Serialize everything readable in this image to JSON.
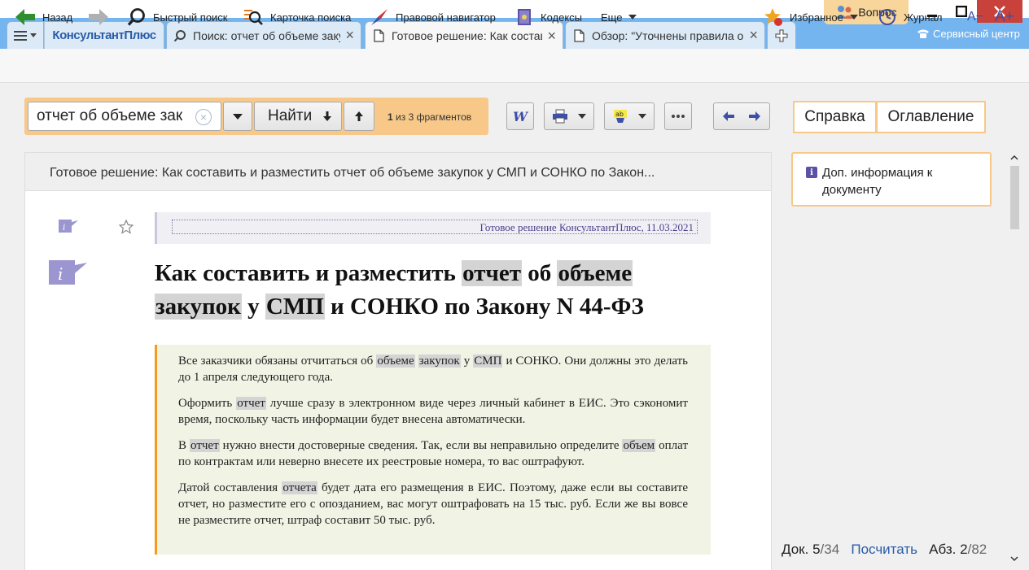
{
  "tabs": {
    "logo": "КонсультантПлюс",
    "items": [
      {
        "label": "Поиск: отчет об объеме закупок",
        "icon": "search-icon"
      },
      {
        "label": "Готовое решение: Как составить",
        "icon": "document-icon"
      },
      {
        "label": "Обзор: \"Уточнены правила оп",
        "icon": "document-icon"
      }
    ]
  },
  "window": {
    "question": "Вопрос",
    "service_center": "Сервисный центр"
  },
  "toolbar": {
    "back": "Назад",
    "quick_search": "Быстрый поиск",
    "search_card": "Карточка поиска",
    "legal_navigator": "Правовой навигатор",
    "codes": "Кодексы",
    "more": "Еще",
    "favorites": "Избранное",
    "journal": "Журнал",
    "font_smaller": "A−",
    "font_bigger": "A+"
  },
  "search": {
    "value": "отчет об объеме зак",
    "find_label": "Найти",
    "fragment_count": "1",
    "fragment_text": "из 3 фрагментов"
  },
  "side": {
    "help_tab": "Справка",
    "contents_tab": "Оглавление",
    "info_label": "Доп. информация к документу"
  },
  "document": {
    "title_bar": "Готовое решение: Как составить и разместить отчет об объеме закупок у СМП и СОНКО по Закон...",
    "source": "Готовое решение КонсультантПлюс, 11.03.2021",
    "heading": {
      "p1": "Как составить и разместить ",
      "w1": "отчет",
      "p2": " об ",
      "w2": "объеме",
      "w3": "закупок",
      "p3": " у ",
      "w4": "СМП",
      "p4": " и СОНКО по Закону N 44-ФЗ"
    },
    "summary": {
      "par1": {
        "a": "Все заказчики обязаны отчитаться об ",
        "h1": "объеме",
        "b": " ",
        "h2": "закупок",
        "c": " у ",
        "h3": "СМП",
        "d": " и СОНКО. Они должны это делать до 1 апреля следующего года."
      },
      "par2": {
        "a": "Оформить ",
        "h1": "отчет",
        "b": " лучше сразу в электронном виде через личный кабинет в ЕИС. Это сэкономит время, поскольку часть информации будет внесена автоматически."
      },
      "par3": {
        "a": "В ",
        "h1": "отчет",
        "b": " нужно внести достоверные сведения. Так, если вы неправильно определите ",
        "h2": "объем",
        "c": " оплат по контрактам или неверно внесете их реестровые номера, то вас оштрафуют."
      },
      "par4": {
        "a": "Датой составления ",
        "h1": "отчета",
        "b": " будет дата его размещения в ЕИС. Поэтому, даже если вы составите отчет, но разместите его с опозданием, вас могут оштрафовать на 15 тыс. руб. Если же вы вовсе не разместите отчет, штраф составит 50 тыс. руб."
      }
    }
  },
  "status": {
    "doc_label": "Док.",
    "doc_current": "5",
    "doc_total": "/34",
    "count_link": "Посчитать",
    "par_label": "Абз.",
    "par_current": "2",
    "par_total": "/82"
  },
  "colors": {
    "tabstrip": "#74b5f0",
    "accent_orange": "#f8c888",
    "highlight": "#d4d4d4",
    "summary_bar": "#f39c1e",
    "link": "#2a5ca8",
    "info_violet": "#5b52a8"
  }
}
